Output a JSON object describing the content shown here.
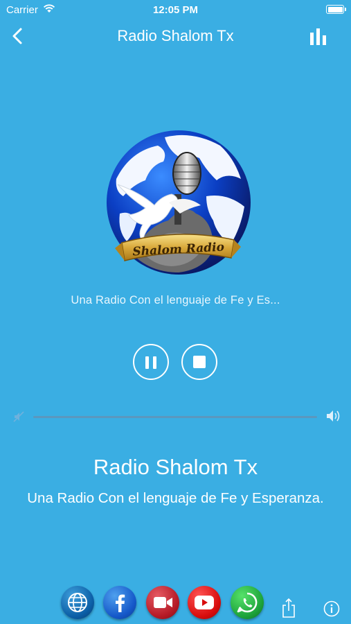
{
  "status_bar": {
    "carrier": "Carrier",
    "time": "12:05 PM",
    "battery_level": 1.0
  },
  "nav": {
    "title": "Radio Shalom Tx",
    "back_icon": "chevron-left-icon",
    "equalizer_icon": "bar-chart-icon"
  },
  "logo": {
    "banner_text": "Shalom Radio"
  },
  "now_playing": {
    "subtitle_truncated": "Una Radio Con el lenguaje de Fe y Es..."
  },
  "controls": {
    "pause_icon": "pause-icon",
    "stop_icon": "stop-icon"
  },
  "volume": {
    "level": 1.0
  },
  "station": {
    "name": "Radio Shalom Tx",
    "slogan": "Una Radio Con el lenguaje de Fe y Esperanza."
  },
  "footer": {
    "icons": [
      "globe-icon",
      "facebook-icon",
      "video-icon",
      "youtube-icon",
      "whatsapp-icon",
      "share-icon",
      "info-icon"
    ]
  },
  "colors": {
    "background": "#3aaee3",
    "text": "#ffffff"
  }
}
